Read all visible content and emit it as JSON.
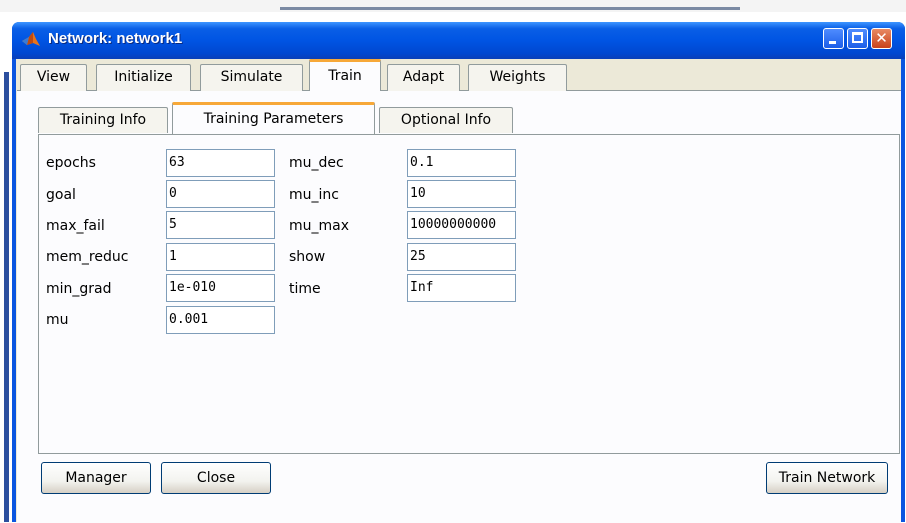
{
  "window": {
    "title": "Network: network1",
    "close_glyph": "✕"
  },
  "tabs": [
    "View",
    "Initialize",
    "Simulate",
    "Train",
    "Adapt",
    "Weights"
  ],
  "active_tab": "Train",
  "subtabs": [
    "Training Info",
    "Training Parameters",
    "Optional Info"
  ],
  "active_subtab": "Training Parameters",
  "params_left": [
    {
      "label": "epochs",
      "value": "63"
    },
    {
      "label": "goal",
      "value": "0"
    },
    {
      "label": "max_fail",
      "value": "5"
    },
    {
      "label": "mem_reduc",
      "value": "1"
    },
    {
      "label": "min_grad",
      "value": "1e-010"
    },
    {
      "label": "mu",
      "value": "0.001"
    }
  ],
  "params_right": [
    {
      "label": "mu_dec",
      "value": "0.1"
    },
    {
      "label": "mu_inc",
      "value": "10"
    },
    {
      "label": "mu_max",
      "value": "10000000000"
    },
    {
      "label": "show",
      "value": "25"
    },
    {
      "label": "time",
      "value": "Inf"
    }
  ],
  "buttons": {
    "manager": "Manager",
    "close": "Close",
    "train": "Train Network"
  },
  "colors": {
    "title_bar": "#0054e3",
    "active_tab_accent": "#f7a838",
    "panel_bg": "#ece9d8"
  },
  "icons": {
    "app": "matlab-logo-icon",
    "minimize": "minimize-icon",
    "maximize": "maximize-icon",
    "close": "close-icon"
  }
}
